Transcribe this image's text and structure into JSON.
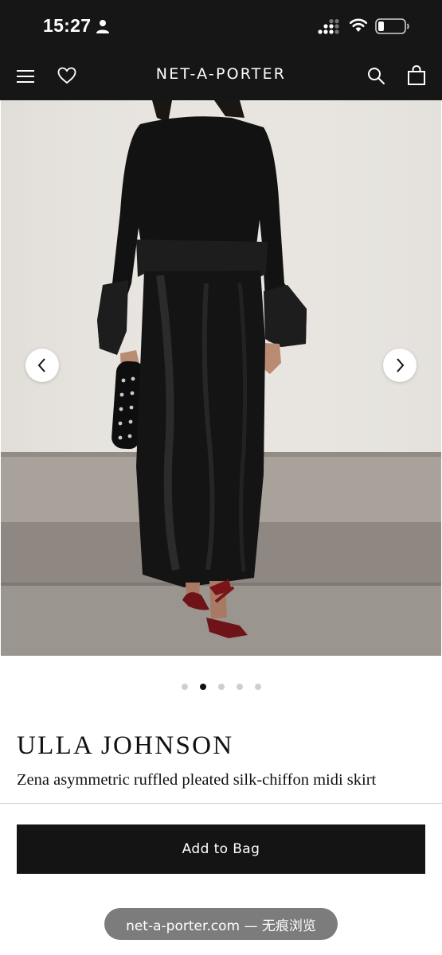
{
  "status_bar": {
    "time": "15:27",
    "icons": [
      "person-icon",
      "signal-icon",
      "wifi-icon",
      "battery-icon"
    ]
  },
  "header": {
    "logo": "NET-A-PORTER",
    "icons": [
      "menu-icon",
      "heart-icon",
      "search-icon",
      "bag-icon"
    ]
  },
  "gallery": {
    "total_images": 5,
    "active_index": 2,
    "controls": [
      "chevron-left-icon",
      "chevron-right-icon"
    ]
  },
  "product": {
    "brand": "ULLA JOHNSON",
    "title": "Zena asymmetric ruffled pleated silk-chiffon midi skirt"
  },
  "actions": {
    "add_to_bag": "Add to Bag"
  },
  "browser": {
    "url_label": "net-a-porter.com — 无痕浏览"
  },
  "colors": {
    "header_bg": "#161616",
    "button_bg": "#141414",
    "pill_bg": "#7c7c7c",
    "dot_active": "#111111",
    "dot_inactive": "#cfcfcf"
  }
}
